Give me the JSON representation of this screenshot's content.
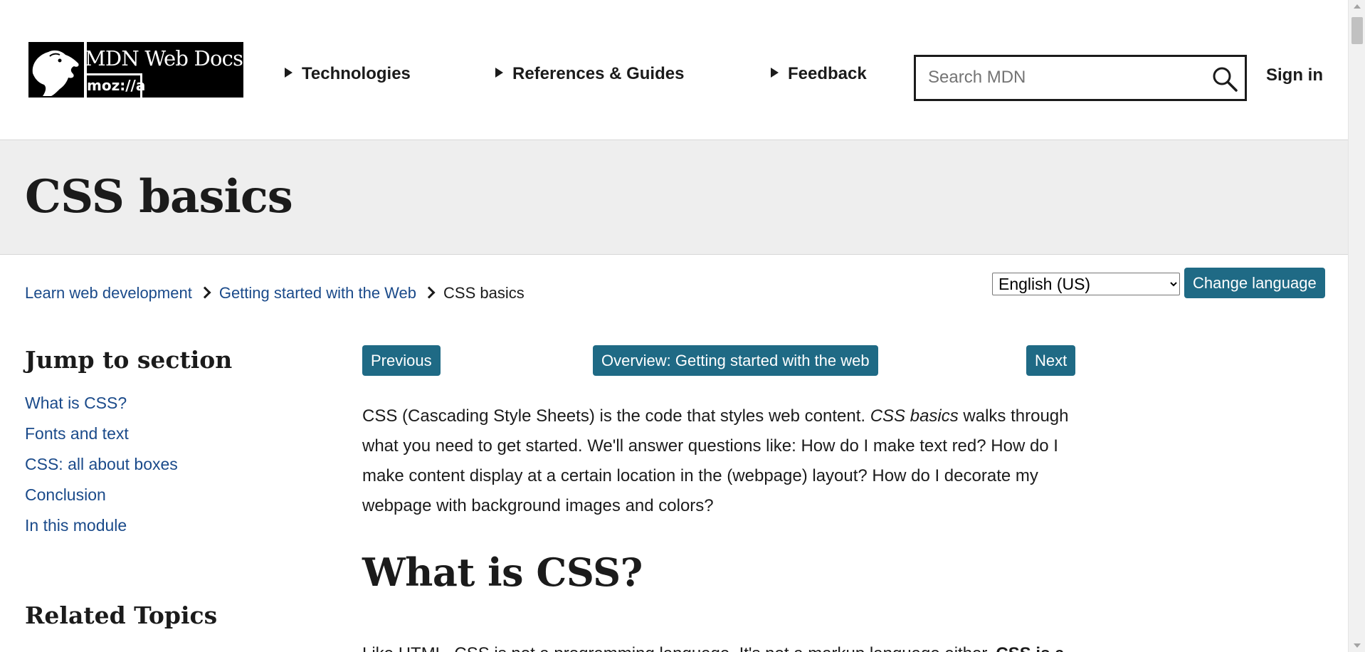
{
  "header": {
    "logo": {
      "title": "MDN Web Docs",
      "subtitle": "moz://a",
      "icon": "dinosaur-head-icon"
    },
    "nav": [
      {
        "label": "Technologies",
        "icon": "triangle-right-icon"
      },
      {
        "label": "References & Guides",
        "icon": "triangle-right-icon"
      },
      {
        "label": "Feedback",
        "icon": "triangle-right-icon"
      }
    ],
    "search": {
      "placeholder": "Search MDN",
      "value": "",
      "icon": "search-icon"
    },
    "sign_in_label": "Sign in"
  },
  "page": {
    "title": "CSS basics"
  },
  "breadcrumb": {
    "items": [
      {
        "label": "Learn web development"
      },
      {
        "label": "Getting started with the Web"
      }
    ],
    "current": "CSS basics"
  },
  "language": {
    "selected": "English (US)",
    "button_label": "Change language"
  },
  "sidebar": {
    "jump_heading": "Jump to section",
    "jump_items": [
      {
        "label": "What is CSS?"
      },
      {
        "label": "Fonts and text"
      },
      {
        "label": "CSS: all about boxes"
      },
      {
        "label": "Conclusion"
      },
      {
        "label": "In this module"
      }
    ],
    "related_heading": "Related Topics"
  },
  "main": {
    "prev_label": "Previous",
    "overview_label": "Overview: Getting started with the web",
    "next_label": "Next",
    "intro": {
      "part1": "CSS (Cascading Style Sheets) is the code that styles web content. ",
      "emphasis": "CSS basics",
      "part2": " walks through what you need to get started. We'll answer questions like: How do I make text red? How do I make content display at a certain location in the (webpage) layout? How do I decorate my webpage with background images and colors?"
    },
    "section_heading": "What is CSS?",
    "cut_paragraph": {
      "text": "Like HTML, CSS is not a programming language. It's not a markup language either. ",
      "bold": "CSS is a"
    }
  },
  "colors": {
    "button_bg": "#1f6a85",
    "link": "#1a4a8a",
    "title_band": "#eeeeee",
    "text": "#1b1b1b"
  }
}
